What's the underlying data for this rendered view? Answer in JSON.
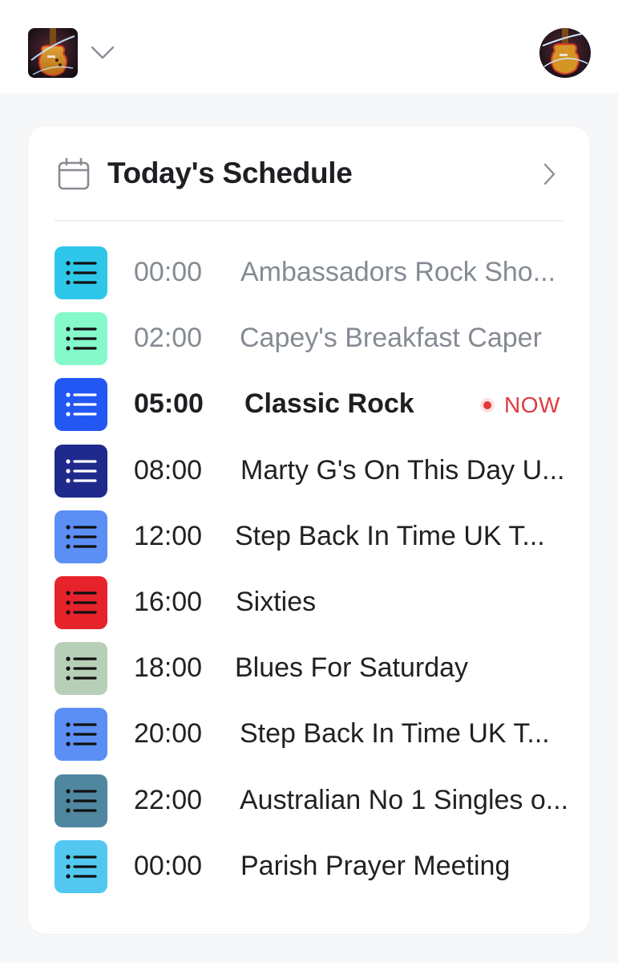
{
  "header": {
    "station_logo_alt": "Station logo (guitar artwork)",
    "station_switcher_icon": "chevron-down-icon",
    "avatar_alt": "User avatar (guitar artwork)"
  },
  "schedule_card": {
    "title": "Today's Schedule",
    "title_icon": "calendar-icon",
    "open_icon": "chevron-right-icon",
    "now_label": "NOW",
    "items": [
      {
        "time": "00:00",
        "title": "Ambassadors Rock Sho...",
        "state": "past",
        "tile_color": "#2ec7ea",
        "glyph_color": "#111111",
        "icon": "list-icon"
      },
      {
        "time": "02:00",
        "title": "Capey's Breakfast Caper",
        "state": "past",
        "tile_color": "#86f9cb",
        "glyph_color": "#111111",
        "icon": "list-icon"
      },
      {
        "time": "05:00",
        "title": "Classic Rock",
        "state": "current",
        "tile_color": "#2357f4",
        "glyph_color": "#ffffff",
        "icon": "list-icon"
      },
      {
        "time": "08:00",
        "title": "Marty G's On This Day U...",
        "state": "upcoming",
        "tile_color": "#1f2a8c",
        "glyph_color": "#ffffff",
        "icon": "list-icon"
      },
      {
        "time": "12:00",
        "title": "Step Back In Time UK T...",
        "state": "upcoming",
        "tile_color": "#5b8ff6",
        "glyph_color": "#111111",
        "icon": "list-icon"
      },
      {
        "time": "16:00",
        "title": "Sixties",
        "state": "upcoming",
        "tile_color": "#e6232b",
        "glyph_color": "#111111",
        "icon": "list-icon"
      },
      {
        "time": "18:00",
        "title": "Blues For Saturday",
        "state": "upcoming",
        "tile_color": "#b7cfb7",
        "glyph_color": "#111111",
        "icon": "list-icon"
      },
      {
        "time": "20:00",
        "title": "Step Back In Time UK T...",
        "state": "upcoming",
        "tile_color": "#5b8ff6",
        "glyph_color": "#111111",
        "icon": "list-icon"
      },
      {
        "time": "22:00",
        "title": "Australian No 1 Singles o...",
        "state": "upcoming",
        "tile_color": "#4f87a0",
        "glyph_color": "#111111",
        "icon": "list-icon"
      },
      {
        "time": "00:00",
        "title": "Parish Prayer Meeting",
        "state": "upcoming",
        "tile_color": "#52c8f1",
        "glyph_color": "#111111",
        "icon": "list-icon"
      }
    ]
  }
}
